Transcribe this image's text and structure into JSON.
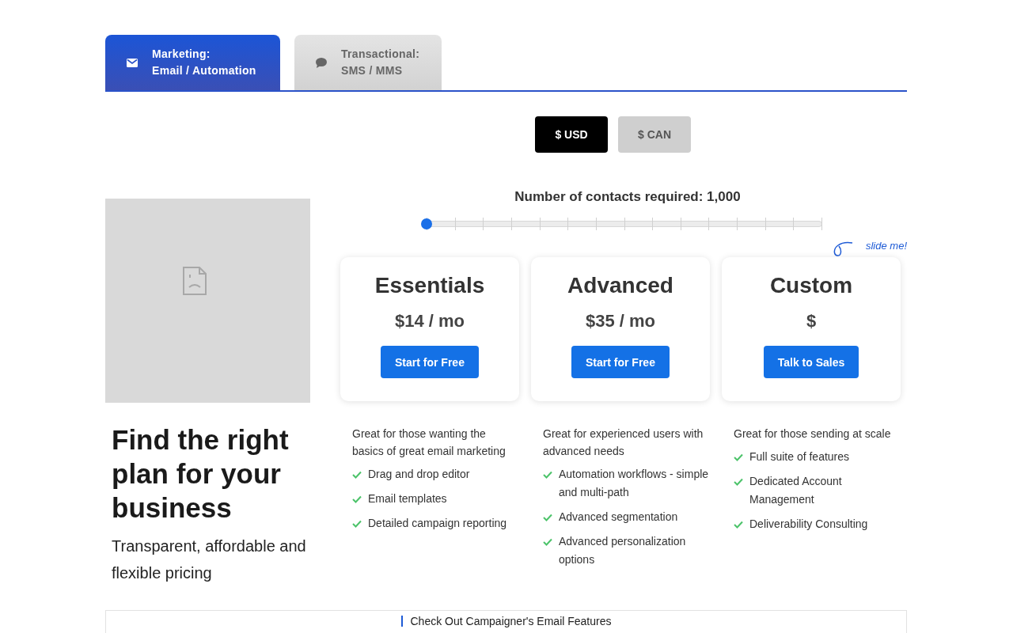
{
  "tabs": [
    {
      "label": "Marketing:",
      "sublabel": "Email / Automation",
      "selected": true
    },
    {
      "label": "Transactional:",
      "sublabel": "SMS / MMS",
      "selected": false
    }
  ],
  "currencies": [
    {
      "label": "$ USD",
      "selected": true
    },
    {
      "label": "$ CAN",
      "selected": false
    }
  ],
  "hero": {
    "heading": "Find the right plan for your business",
    "subheading": "Transparent, affordable and flexible pricing"
  },
  "slider": {
    "label": "Number of contacts required: 1,000",
    "level": 0,
    "hint": "slide me!"
  },
  "plans": [
    {
      "name": "Essentials",
      "price": "$14 / mo",
      "button": "Start for Free",
      "description": "Great for those wanting the basics of great email marketing",
      "features": [
        "Drag and drop editor",
        "Email templates",
        "Detailed campaign reporting"
      ]
    },
    {
      "name": "Advanced",
      "price": "$35 / mo",
      "button": "Start for Free",
      "description": "Great for experienced users with advanced needs",
      "features": [
        "Automation workflows - simple and multi-path",
        "Advanced segmentation",
        "Advanced personalization options"
      ]
    },
    {
      "name": "Custom",
      "price": "$",
      "button": "Talk to Sales",
      "description": "Great for those sending at scale",
      "features": [
        "Full suite of features",
        "Dedicated Account Management",
        "Deliverability Consulting"
      ]
    }
  ],
  "footer_link": "Check Out Campaigner's Email Features"
}
